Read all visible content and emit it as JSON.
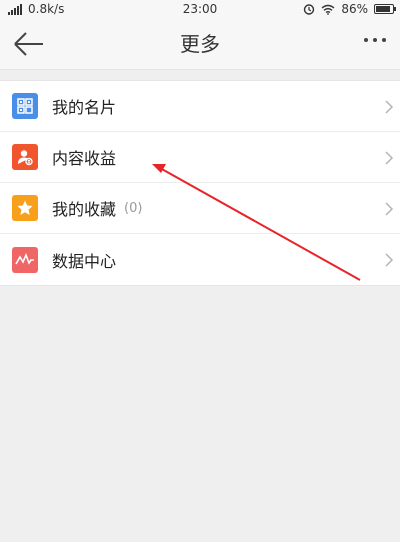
{
  "status_bar": {
    "network_speed": "0.8k/s",
    "time": "23:00",
    "battery_percent": "86%",
    "battery_level": 0.86,
    "icons": [
      "signal-icon",
      "alarm-icon",
      "wifi-icon",
      "battery-icon"
    ]
  },
  "header": {
    "title": "更多",
    "back_icon": "back-arrow-icon",
    "more_icon": "more-dots-icon"
  },
  "menu": {
    "items": [
      {
        "label": "我的名片",
        "icon": "business-card-icon",
        "color": "#4a8fe7"
      },
      {
        "label": "内容收益",
        "icon": "earnings-icon",
        "color": "#f0552e"
      },
      {
        "label": "我的收藏",
        "count": "(0)",
        "icon": "star-icon",
        "color": "#f8a01c"
      },
      {
        "label": "数据中心",
        "icon": "data-chart-icon",
        "color": "#f06565"
      }
    ]
  },
  "annotation": {
    "color": "#e8232a",
    "points_to": "内容收益"
  }
}
